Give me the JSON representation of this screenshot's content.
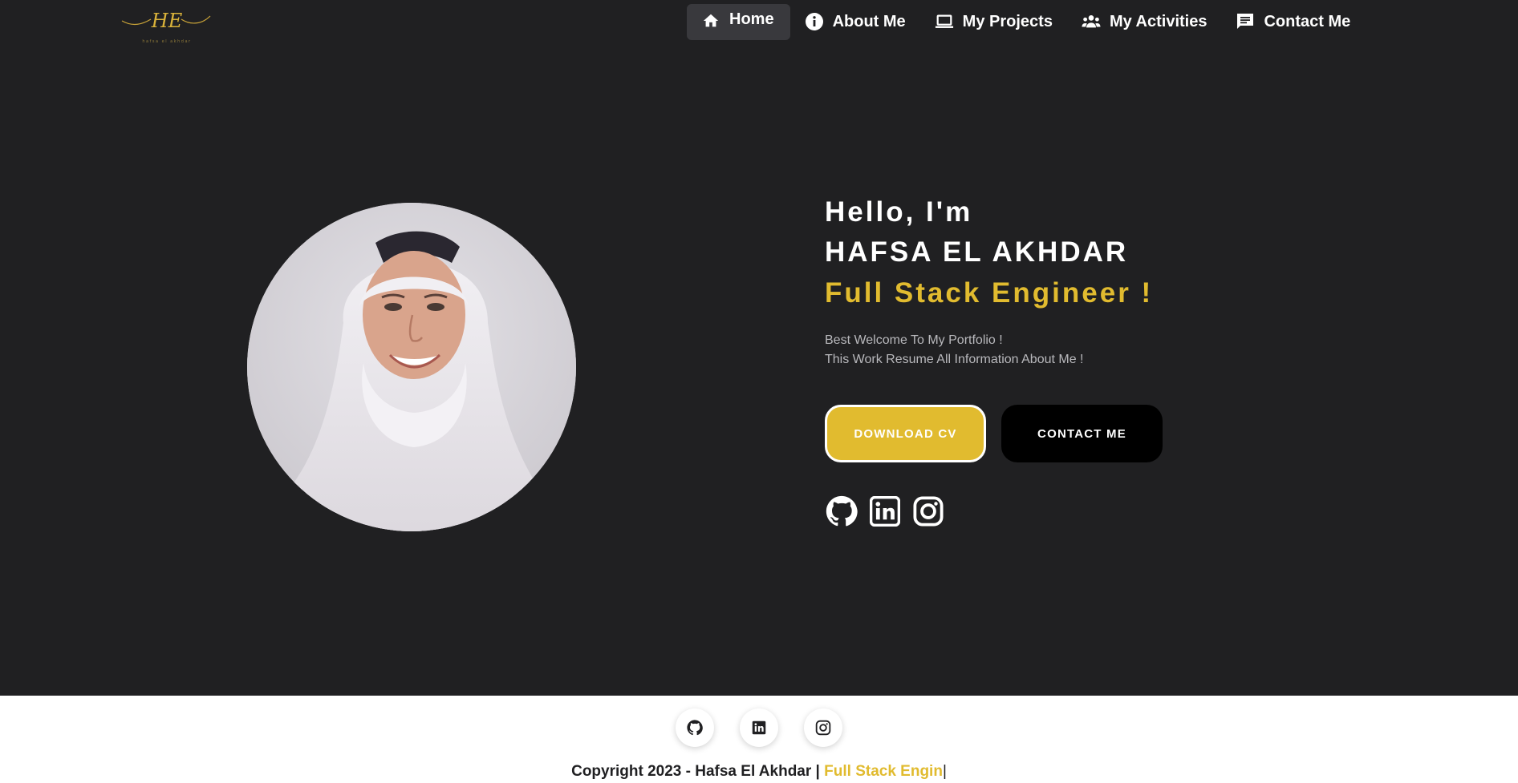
{
  "logo": {
    "monogram": "HE",
    "tagline": "hafsa el akhdar"
  },
  "nav": {
    "items": [
      {
        "label": "Home",
        "icon": "home-icon"
      },
      {
        "label": "About Me",
        "icon": "info-icon"
      },
      {
        "label": "My Projects",
        "icon": "laptop-icon"
      },
      {
        "label": "My Activities",
        "icon": "group-icon"
      },
      {
        "label": "Contact Me",
        "icon": "chat-icon"
      }
    ]
  },
  "hero": {
    "hello": "Hello, I'm",
    "name": "HAFSA EL AKHDAR",
    "role": "Full Stack Engineer !",
    "welcome_line1": "Best Welcome To My Portfolio !",
    "welcome_line2": "This Work Resume All Information About Me !",
    "download_cv": "DOWNLOAD CV",
    "contact_me": "CONTACT ME",
    "socials": [
      "github-icon",
      "linkedin-icon",
      "instagram-icon"
    ]
  },
  "footer": {
    "icons": [
      "github-icon",
      "linkedin-icon",
      "instagram-icon"
    ],
    "copyright_prefix": "Copyright 2023 - Hafsa El Akhdar | ",
    "copyright_accent": "Full Stack Engin",
    "copyright_cursor": "|"
  },
  "colors": {
    "background": "#202022",
    "accent": "#e1bb2f",
    "footer_bg": "#ffffff",
    "button_dark": "#000000"
  }
}
